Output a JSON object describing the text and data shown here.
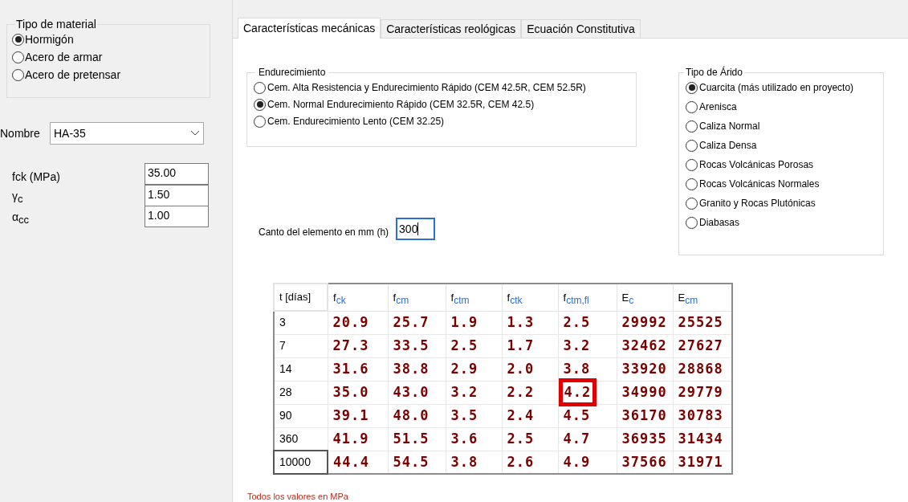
{
  "material_group": {
    "title": "Tipo de material",
    "options": [
      {
        "label": "Hormigón",
        "selected": true
      },
      {
        "label": "Acero de armar",
        "selected": false
      },
      {
        "label": "Acero de pretensar",
        "selected": false
      }
    ]
  },
  "nombre": {
    "label": "Nombre",
    "value": "HA-35"
  },
  "parameters": [
    {
      "label": "fck (MPa)",
      "value": "35.00"
    },
    {
      "label": "γ$_{c}$",
      "value": "1.50"
    },
    {
      "label": "α$_{cc}$",
      "value": "1.00"
    }
  ],
  "tabs": [
    {
      "label": "Características mecánicas",
      "selected": true
    },
    {
      "label": "Características reológicas",
      "selected": false
    },
    {
      "label": "Ecuación Constitutiva",
      "selected": false
    }
  ],
  "endurecimiento": {
    "title": "Endurecimiento",
    "options": [
      {
        "label": "Cem. Alta Resistencia y Endurecimiento Rápido (CEM 42.5R, CEM 52.5R)",
        "selected": false
      },
      {
        "label": "Cem. Normal Endurecimiento Rápido (CEM 32.5R, CEM 42.5)",
        "selected": true
      },
      {
        "label": "Cem. Endurecimiento Lento (CEM 32.25)",
        "selected": false
      }
    ]
  },
  "arido": {
    "title": "Tipo de Árido",
    "options": [
      {
        "label": "Cuarcita (más utilizado en proyecto)",
        "selected": true
      },
      {
        "label": "Arenisca",
        "selected": false
      },
      {
        "label": "Caliza Normal",
        "selected": false
      },
      {
        "label": "Caliza Densa",
        "selected": false
      },
      {
        "label": "Rocas Volcánicas Porosas",
        "selected": false
      },
      {
        "label": "Rocas Volcánicas Normales",
        "selected": false
      },
      {
        "label": "Granito y Rocas Plutónicas",
        "selected": false
      },
      {
        "label": "Diabasas",
        "selected": false
      }
    ]
  },
  "canto": {
    "label": "Canto del elemento en mm (h)",
    "value": "300"
  },
  "table": {
    "columns": [
      "t [días]",
      "f$_{ck}$",
      "f$_{cm}$",
      "f$_{ctm}$",
      "f$_{ctk}$",
      "f$_{ctm,fl}$",
      "E$_{c}$",
      "E$_{cm}$"
    ],
    "rows": [
      {
        "cells": [
          {
            "text": "3",
            "focused": false
          },
          {
            "text": "20.9",
            "marked": false
          },
          {
            "text": "25.7",
            "marked": false
          },
          {
            "text": "1.9",
            "marked": false
          },
          {
            "text": "1.3",
            "marked": false
          },
          {
            "text": "2.5",
            "marked": false
          },
          {
            "text": "29992",
            "marked": false
          },
          {
            "text": "25525",
            "marked": false
          }
        ]
      },
      {
        "cells": [
          {
            "text": "7",
            "focused": false
          },
          {
            "text": "27.3",
            "marked": false
          },
          {
            "text": "33.5",
            "marked": false
          },
          {
            "text": "2.5",
            "marked": false
          },
          {
            "text": "1.7",
            "marked": false
          },
          {
            "text": "3.2",
            "marked": false
          },
          {
            "text": "32462",
            "marked": false
          },
          {
            "text": "27627",
            "marked": false
          }
        ]
      },
      {
        "cells": [
          {
            "text": "14",
            "focused": false
          },
          {
            "text": "31.6",
            "marked": false
          },
          {
            "text": "38.8",
            "marked": false
          },
          {
            "text": "2.9",
            "marked": false
          },
          {
            "text": "2.0",
            "marked": false
          },
          {
            "text": "3.8",
            "marked": false
          },
          {
            "text": "33920",
            "marked": false
          },
          {
            "text": "28868",
            "marked": false
          }
        ]
      },
      {
        "cells": [
          {
            "text": "28",
            "focused": false
          },
          {
            "text": "35.0",
            "marked": false
          },
          {
            "text": "43.0",
            "marked": false
          },
          {
            "text": "3.2",
            "marked": false
          },
          {
            "text": "2.2",
            "marked": false
          },
          {
            "text": "4.2",
            "marked": true
          },
          {
            "text": "34990",
            "marked": false
          },
          {
            "text": "29779",
            "marked": false
          }
        ]
      },
      {
        "cells": [
          {
            "text": "90",
            "focused": false
          },
          {
            "text": "39.1",
            "marked": false
          },
          {
            "text": "48.0",
            "marked": false
          },
          {
            "text": "3.5",
            "marked": false
          },
          {
            "text": "2.4",
            "marked": false
          },
          {
            "text": "4.5",
            "marked": false
          },
          {
            "text": "36170",
            "marked": false
          },
          {
            "text": "30783",
            "marked": false
          }
        ]
      },
      {
        "cells": [
          {
            "text": "360",
            "focused": false
          },
          {
            "text": "41.9",
            "marked": false
          },
          {
            "text": "51.5",
            "marked": false
          },
          {
            "text": "3.6",
            "marked": false
          },
          {
            "text": "2.5",
            "marked": false
          },
          {
            "text": "4.7",
            "marked": false
          },
          {
            "text": "36935",
            "marked": false
          },
          {
            "text": "31434",
            "marked": false
          }
        ]
      },
      {
        "cells": [
          {
            "text": "10000",
            "focused": true
          },
          {
            "text": "44.4",
            "marked": false
          },
          {
            "text": "54.5",
            "marked": false
          },
          {
            "text": "3.8",
            "marked": false
          },
          {
            "text": "2.6",
            "marked": false
          },
          {
            "text": "4.9",
            "marked": false
          },
          {
            "text": "37566",
            "marked": false
          },
          {
            "text": "31971",
            "marked": false
          }
        ]
      }
    ]
  },
  "footnote": "Todos los valores en MPa"
}
